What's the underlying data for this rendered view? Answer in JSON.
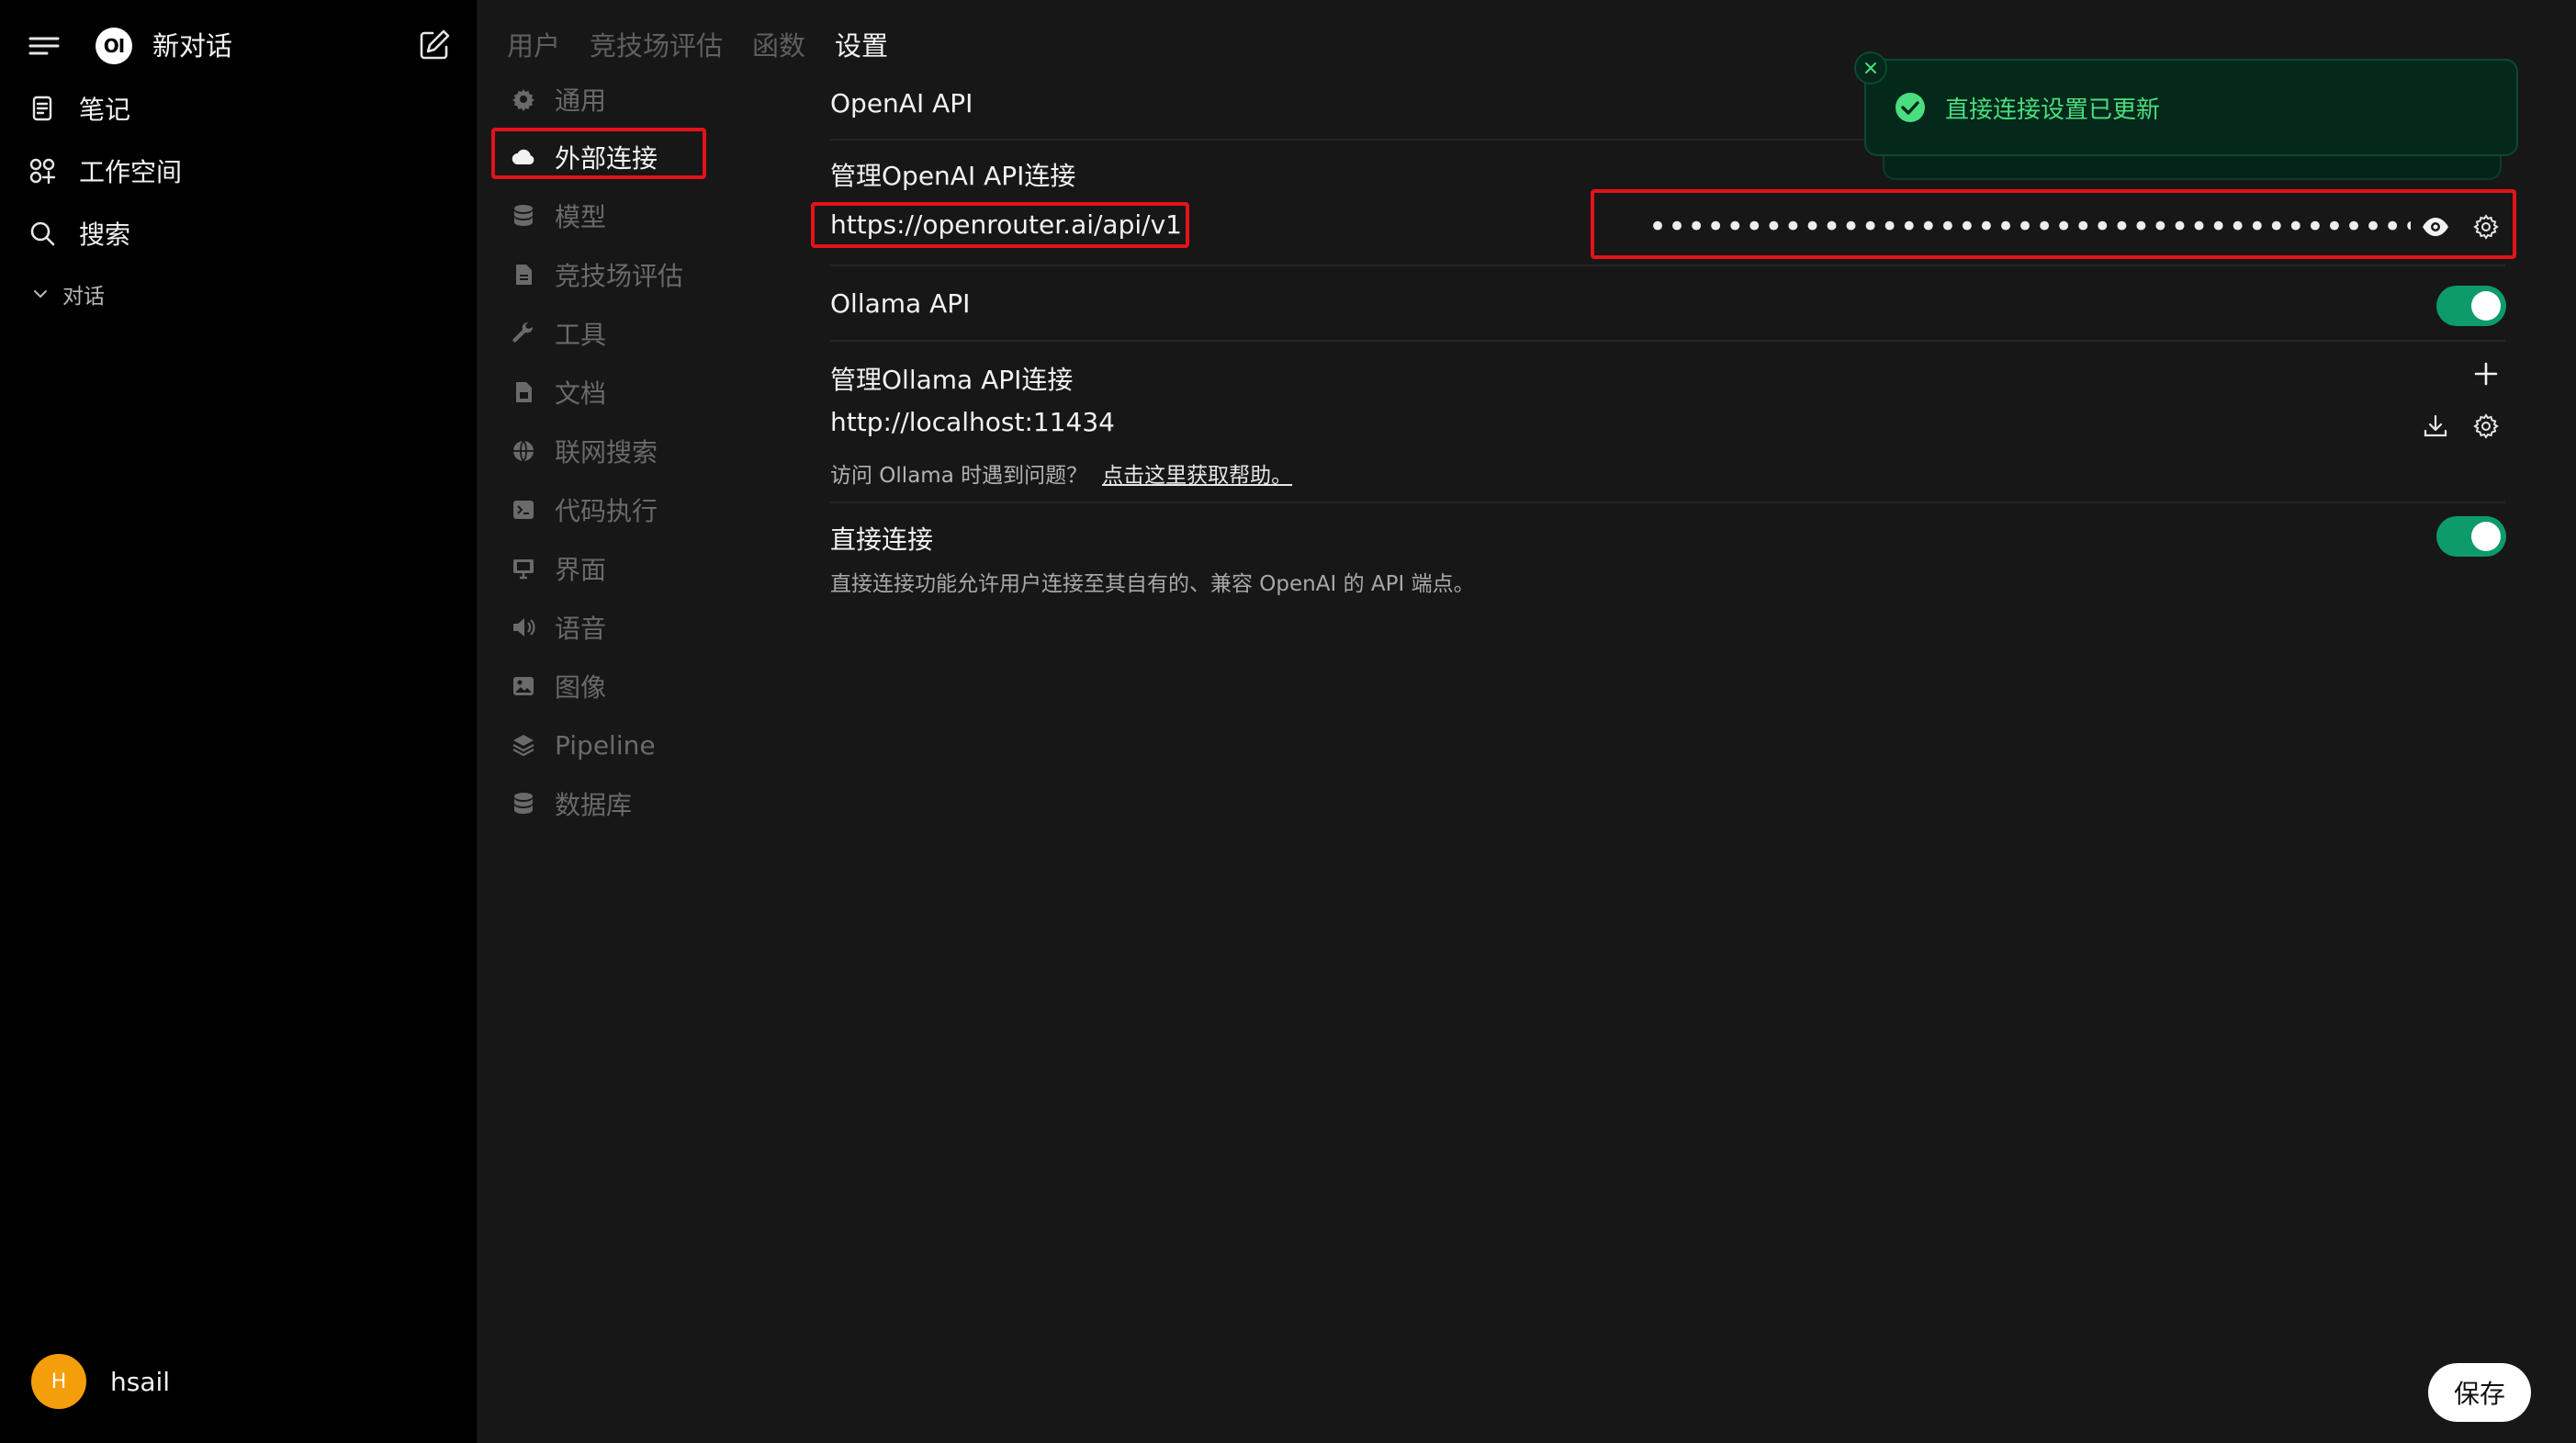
{
  "sidebar": {
    "new_chat_label": "新对话",
    "logo_text": "OI",
    "items": [
      {
        "label": "笔记",
        "icon": "notes-icon"
      },
      {
        "label": "工作空间",
        "icon": "workspace-icon"
      },
      {
        "label": "搜索",
        "icon": "search-icon"
      }
    ],
    "group_label": "对话",
    "user": {
      "initial": "H",
      "name": "hsail"
    }
  },
  "tabs": [
    {
      "label": "用户",
      "active": false
    },
    {
      "label": "竞技场评估",
      "active": false
    },
    {
      "label": "函数",
      "active": false
    },
    {
      "label": "设置",
      "active": true
    }
  ],
  "settings_nav": [
    {
      "label": "通用",
      "icon": "gear-icon"
    },
    {
      "label": "外部连接",
      "icon": "cloud-icon",
      "active": true
    },
    {
      "label": "模型",
      "icon": "database-icon"
    },
    {
      "label": "竞技场评估",
      "icon": "document-icon"
    },
    {
      "label": "工具",
      "icon": "wrench-icon"
    },
    {
      "label": "文档",
      "icon": "file-icon"
    },
    {
      "label": "联网搜索",
      "icon": "globe-icon"
    },
    {
      "label": "代码执行",
      "icon": "terminal-icon"
    },
    {
      "label": "界面",
      "icon": "monitor-icon"
    },
    {
      "label": "语音",
      "icon": "speaker-icon"
    },
    {
      "label": "图像",
      "icon": "image-icon"
    },
    {
      "label": "Pipeline",
      "icon": "layers-icon"
    },
    {
      "label": "数据库",
      "icon": "database-icon"
    }
  ],
  "content": {
    "openai_title": "OpenAI API",
    "openai_manage_title": "管理OpenAI API连接",
    "openai_url": "https://openrouter.ai/api/v1",
    "openai_key_masked": "••••••••••••••••••••••••••••••••••••••••••••••••••••••••••••••",
    "ollama_title": "Ollama API",
    "ollama_enabled": true,
    "ollama_manage_title": "管理Ollama API连接",
    "ollama_url": "http://localhost:11434",
    "ollama_help_text": "访问 Ollama 时遇到问题？",
    "ollama_help_link": "点击这里获取帮助。",
    "direct_title": "直接连接",
    "direct_enabled": true,
    "direct_desc": "直接连接功能允许用户连接至其自有的、兼容 OpenAI 的 API 端点。",
    "save_label": "保存"
  },
  "toast": {
    "message": "直接连接设置已更新",
    "type": "success"
  },
  "colors": {
    "accent_green": "#0d9b6a",
    "toast_text": "#4ade80",
    "highlight_red": "#e3121b"
  }
}
